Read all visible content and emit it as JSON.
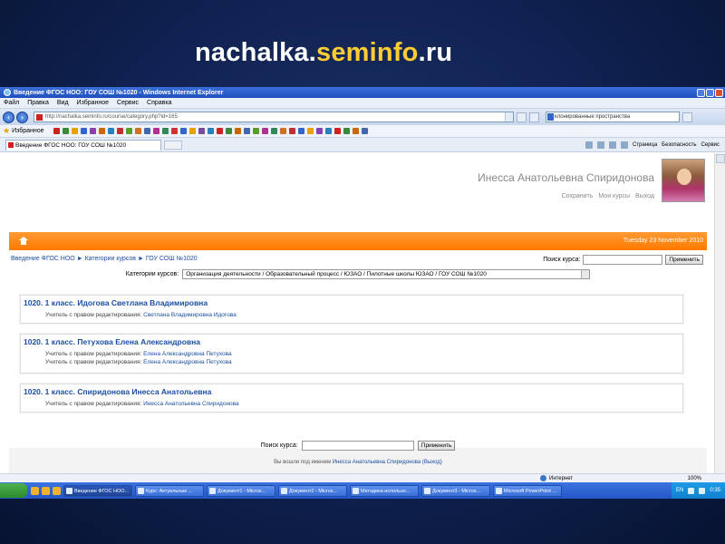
{
  "slide": {
    "title_prefix": "nachalka.",
    "title_highlight": "seminfo",
    "title_suffix": ".ru"
  },
  "browser": {
    "window_title": "Введение ФГОС НОО: ГОУ СОШ №1020 - Windows Internet Explorer",
    "menu": [
      "Файл",
      "Правка",
      "Вид",
      "Избранное",
      "Сервис",
      "Справка"
    ],
    "address": "http://nachalka.seminfo.ru/course/category.php?id=165",
    "search_value": "клонированные пространства",
    "favorites_label": "Избранное",
    "tab_title": "Введение ФГОС НОО: ГОУ СОШ №1020",
    "cmd_items": [
      "Страница",
      "Безопасность",
      "Сервис"
    ],
    "status_zone": "Интернет",
    "zoom": "100%"
  },
  "page": {
    "user_name": "Инесса Анатольевна Спиридонова",
    "user_links": [
      "Сохранить",
      "Мои курсы",
      "Выход"
    ],
    "date": "Tuesday 23 November 2010",
    "breadcrumb": "Введение ФГОС НОО ► Категории курсов ► ГОУ СОШ №1020",
    "search_label": "Поиск курса:",
    "apply_label": "Применить",
    "category_label": "Категории курсов:",
    "category_value": "Организация деятельности / Образовательный процесс / ЮЗАО / Пилотные школы ЮЗАО / ГОУ СОШ №1020",
    "courses": [
      {
        "title": "1020. 1 класс. Идогова Светлана Владимировна",
        "teachers": [
          {
            "role": "Учитель с правом редактирования:",
            "name": "Светлана Владимировна Идогова"
          }
        ]
      },
      {
        "title": "1020. 1 класс. Петухова Елена Александровна",
        "teachers": [
          {
            "role": "Учитель с правом редактирования:",
            "name": "Елена Александровна Петухова"
          },
          {
            "role": "Учитель с правом редактирования:",
            "name": "Елена Александровна Петухова"
          }
        ]
      },
      {
        "title": "1020. 1 класс. Спиридонова Инесса Анатольевна",
        "teachers": [
          {
            "role": "Учитель с правом редактирования:",
            "name": "Инесса Анатольевна Спиридонова"
          }
        ]
      }
    ],
    "bottom_search_label": "Поиск курса:",
    "bottom_apply_label": "Применить",
    "logged_in_prefix": "Вы вошли под именем",
    "logged_in_user": "Инесса Анатольевна Спиридонова",
    "logout_label": "(Выход)"
  },
  "taskbar": {
    "tasks": [
      "Введение ФГОС НОО...",
      "Курс: Актуальные ...",
      "Документ1 - Micros...",
      "Документ2 - Micros...",
      "Методика использо...",
      "Документ3 - Micros...",
      "Microsoft PowerPoint ..."
    ],
    "lang": "EN",
    "time": "0:35"
  },
  "colors": {
    "accent_orange": "#ff7a00",
    "link_blue": "#1a4fa3",
    "title_highlight": "#ffcc33"
  }
}
